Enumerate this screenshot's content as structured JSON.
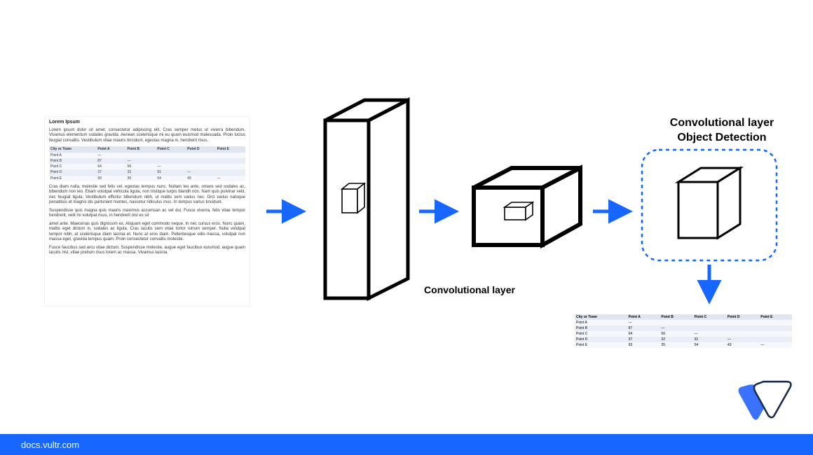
{
  "doc": {
    "title": "Lorem Ipsum",
    "p1": "Lorem ipsum dolor sit amet, consectetur adipiscing elit. Cras semper metus ut viverra bibendum. Vivamus elementum sodales gravida. Aenean scelerisque mi eu quam euismod malesuada. Proin luctus feugiat convallis. Vestibulum vitae mauris tincidunt, egestas magna in, hendrerit risus.",
    "p2": "Cras diam nulla, molestie sed felis vel, egestas tempus nunc. Nullam leo ante, ornare sed sodales ac, bibendum non leo. Etiam volutpat vehicula ligula, non tristique turpis blandit non. Nam quis pulvinar velit, nec feugiat ligula. Vestibulum efficitur bibendum nibh, ut mattis sem varius nec. Orci varius natoque penatibus et magnis dis parturient montes, nascetur ridiculus mus. In tempus varius tincidunt.",
    "p3": "Suspendisse quis magna quis mauris maximus accumsan ac vel dui. Fusce viverra, felis vitae tempor hendrerit, velit mi volutpat risus, in hendrerit nisl ex sit",
    "p4": "amet ante. Maecenas quis dignissim ex. Aliquam eget commodo neque. In nec cursus eros. Nunc quam, mattis eget dictum in, sodales ac ligula. Cras iaculis sem vitae tortor rutrum semper. Nulla volutpat tempor nibh, at scelerisque diam lacinia et. Nunc at eros diam. Pellentesque odio massa, volutpat non massa eget, gravida tempus quam. Proin consectetur convallis molestie.",
    "p5": "Fusce faucibus sed arcu vitae dictum. Suspendisse molestie, augue eget faucibus euismod, augue quam iaculis nisl, vitae pretium risus lorem ac massa. Vivamus lacinia."
  },
  "table": {
    "headers": [
      "City or Town",
      "Point A",
      "Point B",
      "Point C",
      "Point D",
      "Point E"
    ],
    "rows": [
      [
        "Point A",
        "—",
        "",
        "",
        "",
        ""
      ],
      [
        "Point B",
        "87",
        "—",
        "",
        "",
        ""
      ],
      [
        "Point C",
        "64",
        "56",
        "—",
        "",
        ""
      ],
      [
        "Point D",
        "37",
        "32",
        "91",
        "—",
        ""
      ],
      [
        "Point E",
        "93",
        "35",
        "54",
        "43",
        "—"
      ]
    ]
  },
  "labels": {
    "conv": "Convolutional layer",
    "obj_l1": "Convolutional layer",
    "obj_l2": "Object Detection"
  },
  "footer": {
    "text": "docs.vultr.com"
  },
  "colors": {
    "arrow": "#1666ff",
    "dashed": "#1666ff"
  }
}
